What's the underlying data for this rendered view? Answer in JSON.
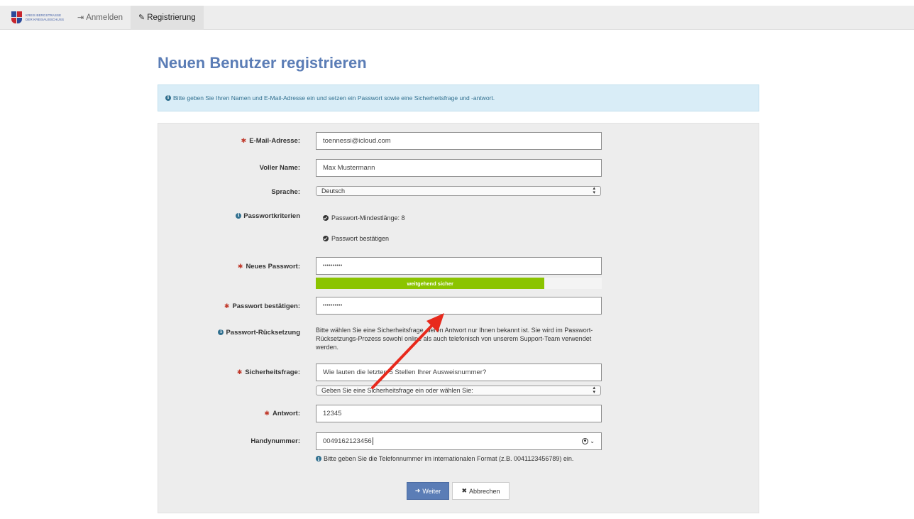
{
  "nav": {
    "brand_line1": "KREIS BERGSTRASSE",
    "brand_line2": "DER KREISAUSSCHUSS",
    "login_label": "Anmelden",
    "register_label": "Registrierung"
  },
  "page": {
    "title": "Neuen Benutzer registrieren",
    "info_text": "Bitte geben Sie Ihren Namen und E-Mail-Adresse ein und setzen ein Passwort sowie eine Sicherheitsfrage und -antwort."
  },
  "form": {
    "email": {
      "label": "E-Mail-Adresse:",
      "value": "toennessi@icloud.com"
    },
    "full_name": {
      "label": "Voller Name:",
      "value": "Max Mustermann"
    },
    "language": {
      "label": "Sprache:",
      "value": "Deutsch"
    },
    "password_criteria": {
      "label": "Passwortkriterien",
      "items": [
        "Passwort-Mindestlänge: 8",
        "Passwort bestätigen"
      ]
    },
    "new_password": {
      "label": "Neues Passwort:",
      "value": "••••••••••"
    },
    "strength": {
      "text": "weitgehend sicher",
      "level_percent": 80,
      "color": "#8bc400"
    },
    "confirm_password": {
      "label": "Passwort bestätigen:",
      "value": "••••••••••"
    },
    "password_reset": {
      "label": "Passwort-Rücksetzung",
      "help": "Bitte wählen Sie eine Sicherheitsfrage, deren Antwort nur Ihnen bekannt ist. Sie wird im Passwort-Rücksetzungs-Prozess sowohl online als auch telefonisch von unserem Support-Team verwendet werden."
    },
    "security_question": {
      "label": "Sicherheitsfrage:",
      "value": "Wie lauten die letzten 5 Stellen Ihrer Ausweisnummer?",
      "select_value": "Geben Sie eine Sicherheitsfrage ein oder wählen Sie:"
    },
    "answer": {
      "label": "Antwort:",
      "value": "12345"
    },
    "phone": {
      "label": "Handynummer:",
      "value": "0049162123456",
      "help": "Bitte geben Sie die Telefonnummer im internationalen Format (z.B. 0041123456789) ein."
    }
  },
  "buttons": {
    "next": "Weiter",
    "cancel": "Abbrechen"
  },
  "colors": {
    "accent": "#5b7db6",
    "required": "#c0392b",
    "info_bg": "#d9edf7",
    "annotation_arrow": "#e8291c"
  },
  "icons": {
    "login": "sign-in-icon",
    "register": "edit-icon",
    "info": "info-circle-icon",
    "check": "check-circle-icon",
    "next": "arrow-right-icon",
    "cancel": "times-icon",
    "contact": "user-circle-icon"
  }
}
